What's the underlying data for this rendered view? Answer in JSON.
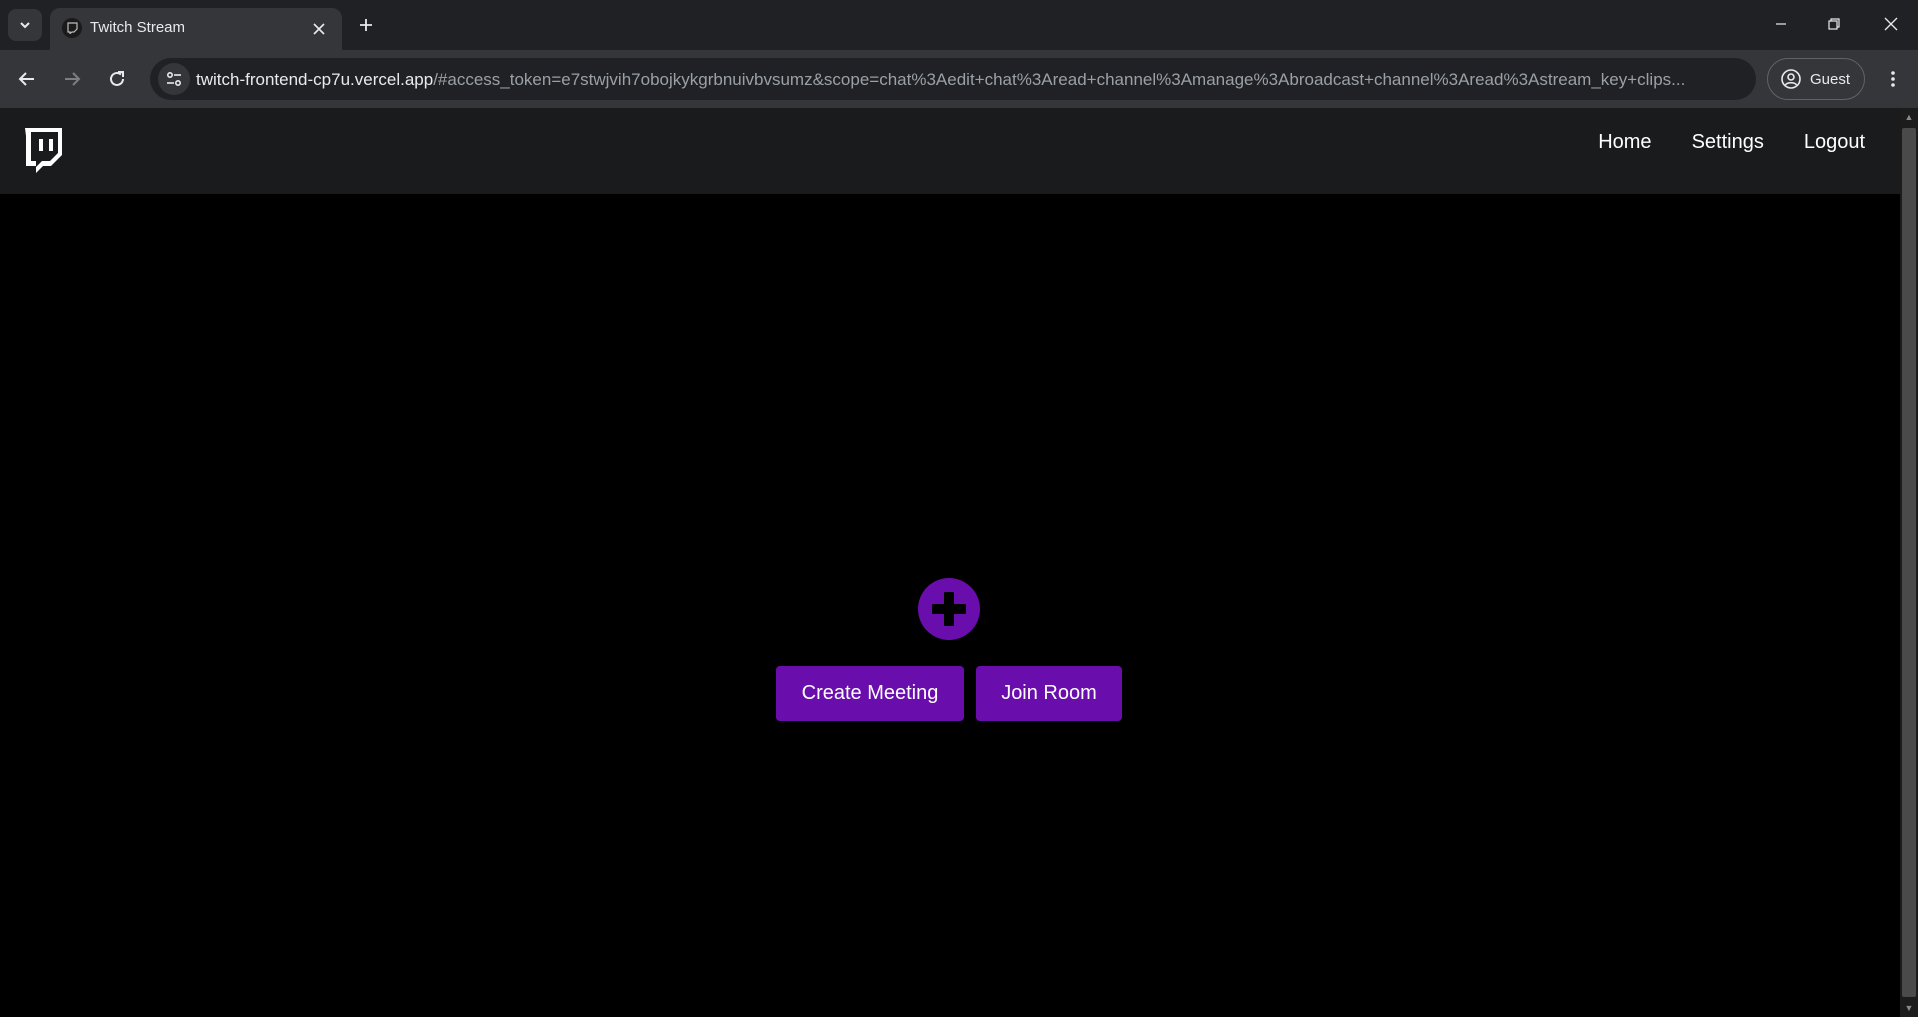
{
  "browser": {
    "tab": {
      "title": "Twitch Stream"
    },
    "url": {
      "host": "twitch-frontend-cp7u.vercel.app",
      "rest": "/#access_token=e7stwjvih7obojkykgrbnuivbvsumz&scope=chat%3Aedit+chat%3Aread+channel%3Amanage%3Abroadcast+channel%3Aread%3Astream_key+clips..."
    },
    "profile": {
      "label": "Guest"
    }
  },
  "navbar": {
    "logo_icon": "twitch-glitch-icon",
    "links": [
      {
        "label": "Home"
      },
      {
        "label": "Settings"
      },
      {
        "label": "Logout"
      }
    ]
  },
  "main": {
    "icon": "plus-icon",
    "buttons": {
      "create": "Create Meeting",
      "join": "Join Room"
    }
  },
  "colors": {
    "accent": "#6a0dad",
    "navbar_bg": "#1a1b1d",
    "page_bg": "#000000"
  }
}
